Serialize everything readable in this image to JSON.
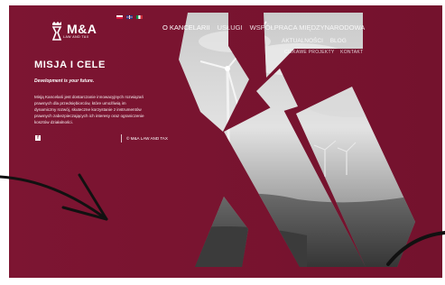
{
  "logo": {
    "name": "M&A",
    "tagline": "LAW AND TAX"
  },
  "languages": [
    {
      "name": "pl-flag-icon"
    },
    {
      "name": "en-flag-icon"
    },
    {
      "name": "it-flag-icon"
    }
  ],
  "nav": {
    "items": [
      "O KANCELARII",
      "USŁUGI",
      "WSPÓŁPRACA MIĘDZYNARODOWA"
    ],
    "subitems": [
      "AKTUALNOŚCI",
      "BLOG"
    ],
    "subitems2": [
      "CIEKAWE PROJEKTY",
      "KONTAKT"
    ]
  },
  "main": {
    "title": "MISJA I CELE",
    "subtitle": "Development is your future.",
    "body_lines": [
      "Misją Kancelarii jest dostarczanie innowacyjnych rozwiązań",
      "prawnych dla przedsiębiorców, które umożliwią im",
      "dynamiczny rozwój, skuteczne korzystanie z instrumentów",
      "prawnych zabezpieczających ich interesy oraz ograniczenie",
      "kosztów działalności."
    ]
  },
  "footer": {
    "social_icon": "facebook-icon",
    "social_glyph": "f",
    "copyright": "© M&A LAW AND TAX"
  },
  "colors": {
    "brand_maroon": "#7b1530",
    "text": "#ffffff"
  }
}
